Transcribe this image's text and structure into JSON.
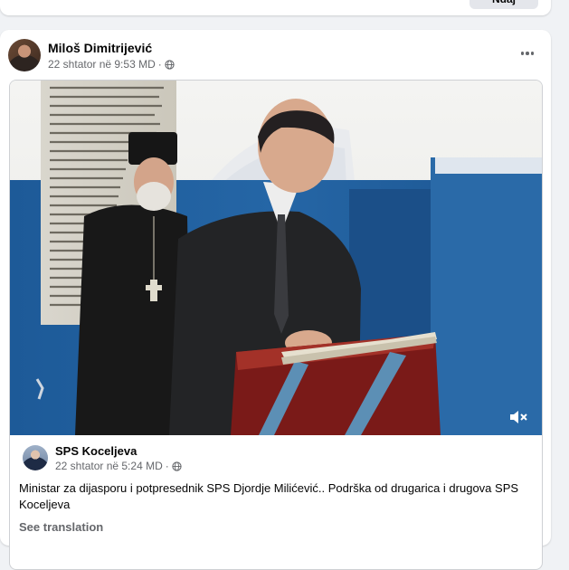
{
  "previous_post": {
    "button_label": "Ndaj"
  },
  "post": {
    "author": "Miloš Dimitrijević",
    "timestamp": "22 shtator në 9:53 MD",
    "separator": "·",
    "audience_icon": "globe-icon",
    "options_icon": "more-options-icon"
  },
  "media": {
    "video_control_icon": "volume-muted-icon"
  },
  "shared_post": {
    "author": "SPS Koceljeva",
    "timestamp": "22 shtator në 5:24 MD",
    "separator": "·",
    "audience_icon": "globe-icon",
    "text": "Ministar za dijasporu i potpresednik SPS Djordje Milićević.. Podrška od drugarica i drugova SPS Koceljeva",
    "translate_label": "See translation"
  },
  "colors": {
    "background": "#f0f2f5",
    "card": "#ffffff",
    "secondary_text": "#65676b",
    "wall_blue": "#1f5e9c"
  }
}
